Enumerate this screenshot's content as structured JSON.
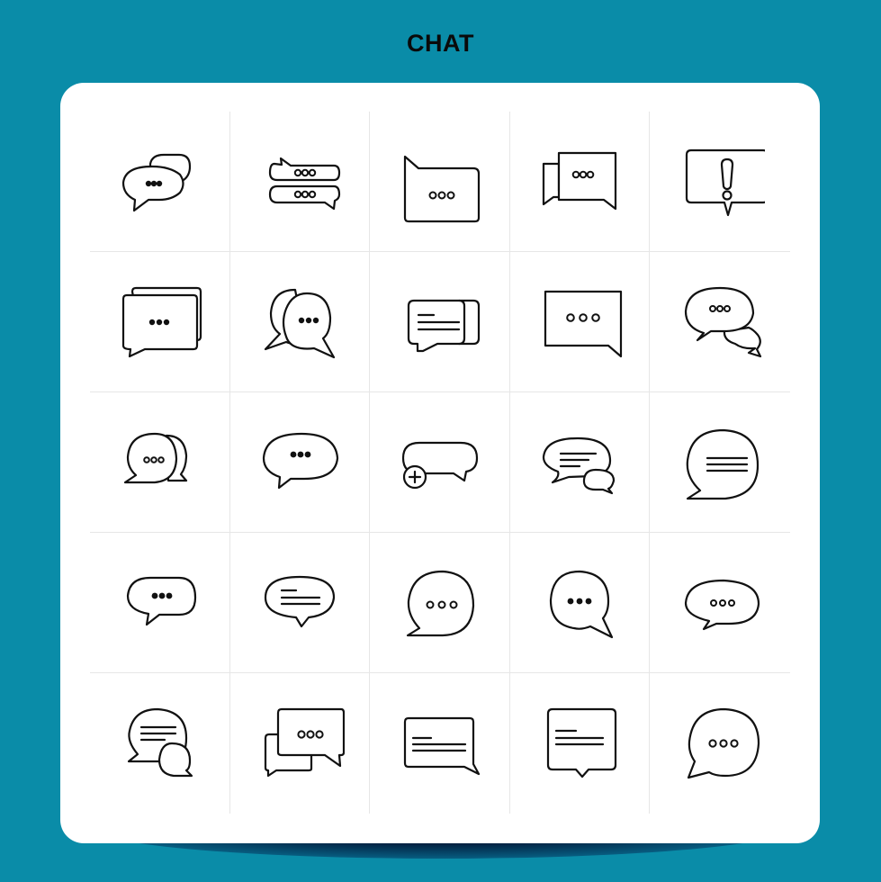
{
  "title": "CHAT",
  "colors": {
    "background": "#0a8ca8",
    "card": "#ffffff",
    "icon_stroke": "#111111",
    "grid_line": "#e6e6e6"
  },
  "icon_set": {
    "style": "line",
    "rows": 5,
    "columns": 5,
    "icons": [
      "two-overlapping-bubbles-dots-icon",
      "stacked-rounded-bubbles-dots-icon",
      "folder-tab-bubble-dots-icon",
      "square-bubbles-overlap-icon",
      "alert-exclamation-bubble-icon",
      "stacked-rect-bubbles-dots-icon",
      "two-round-bubbles-dots-icon",
      "stacked-text-bubbles-icon",
      "square-bubble-dots-icon",
      "two-oval-bubbles-dots-icon",
      "round-bubbles-pair-dots-icon",
      "oval-bubble-dots-icon",
      "add-chat-bubble-icon",
      "oval-text-bubble-reply-icon",
      "round-bubble-lines-icon",
      "rounded-bubble-dots-icon",
      "oval-bubble-text-icon",
      "round-bubble-outline-dots-icon",
      "round-bubble-right-tail-dots-icon",
      "small-oval-bubble-dots-icon",
      "round-bubble-text-reply-icon",
      "square-bubbles-dots-icon",
      "rect-text-bubble-icon",
      "square-note-bubble-icon",
      "round-bubble-left-tail-dots-icon"
    ]
  }
}
